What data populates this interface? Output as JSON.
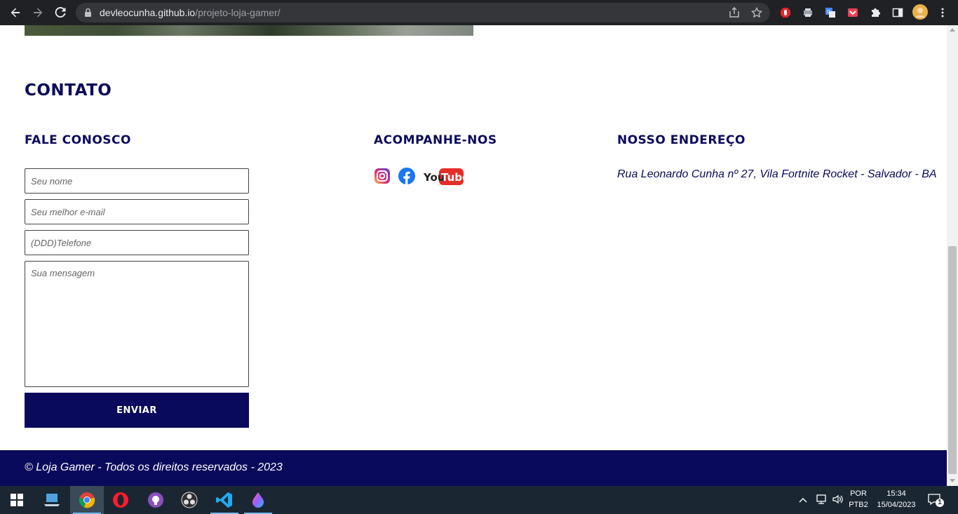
{
  "browser": {
    "url_host": "devleocunha.github.io",
    "url_path": "/projeto-loja-gamer/"
  },
  "contact": {
    "section_title": "Contato",
    "form": {
      "title": "Fale conosco",
      "name_placeholder": "Seu nome",
      "email_placeholder": "Seu melhor e-mail",
      "phone_placeholder": "(DDD)Telefone",
      "message_placeholder": "Sua mensagem",
      "submit_label": "Enviar"
    },
    "social": {
      "title": "Acompanhe-nos",
      "youtube_you": "You",
      "youtube_tube": "Tube"
    },
    "address": {
      "title": "Nosso endereço",
      "text": "Rua Leonardo Cunha nº 27, Vila Fortnite Rocket - Salvador - BA"
    }
  },
  "footer": {
    "text": "© Loja Gamer - Todos os direitos reservados - 2023"
  },
  "taskbar": {
    "lang_top": "POR",
    "lang_bottom": "PTB2",
    "time": "15:34",
    "date": "15/04/2023",
    "notification_count": "1"
  },
  "colors": {
    "brand_navy": "#0a0a5c",
    "chrome_dark": "#202124",
    "taskbar": "#1a2733"
  }
}
